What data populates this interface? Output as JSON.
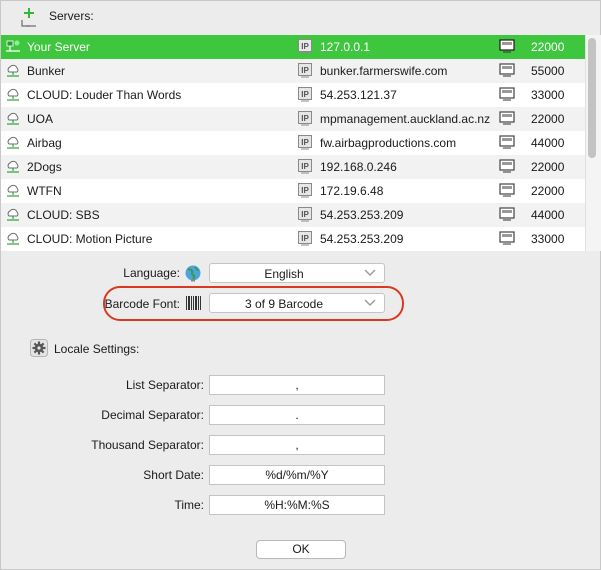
{
  "servers": {
    "label": "Servers:",
    "rows": [
      {
        "name": "Your Server",
        "ip": "127.0.0.1",
        "port": "22000"
      },
      {
        "name": "Bunker",
        "ip": "bunker.farmerswife.com",
        "port": "55000"
      },
      {
        "name": "CLOUD: Louder Than Words",
        "ip": "54.253.121.37",
        "port": "33000"
      },
      {
        "name": "UOA",
        "ip": "mpmanagement.auckland.ac.nz",
        "port": "22000"
      },
      {
        "name": "Airbag",
        "ip": "fw.airbagproductions.com",
        "port": "44000"
      },
      {
        "name": "2Dogs",
        "ip": "192.168.0.246",
        "port": "22000"
      },
      {
        "name": "WTFN",
        "ip": "172.19.6.48",
        "port": "22000"
      },
      {
        "name": "CLOUD: SBS",
        "ip": "54.253.253.209",
        "port": "44000"
      },
      {
        "name": "CLOUD: Motion Picture",
        "ip": "54.253.253.209",
        "port": "33000"
      }
    ],
    "selected_index": 0,
    "ip_badge": "IP",
    "colors": {
      "selected": "#3fc63f",
      "highlight": "#d9391f"
    }
  },
  "language": {
    "label": "Language:",
    "value": "English"
  },
  "barcode": {
    "label": "Barcode Font:",
    "value": "3 of 9 Barcode"
  },
  "locale": {
    "label": "Locale Settings:",
    "list_separator": {
      "label": "List Separator:",
      "value": ","
    },
    "decimal_separator": {
      "label": "Decimal Separator:",
      "value": "."
    },
    "thousand_separator": {
      "label": "Thousand Separator:",
      "value": ","
    },
    "short_date": {
      "label": "Short Date:",
      "value": "%d/%m/%Y"
    },
    "time": {
      "label": "Time:",
      "value": "%H:%M:%S"
    }
  },
  "ok_label": "OK"
}
